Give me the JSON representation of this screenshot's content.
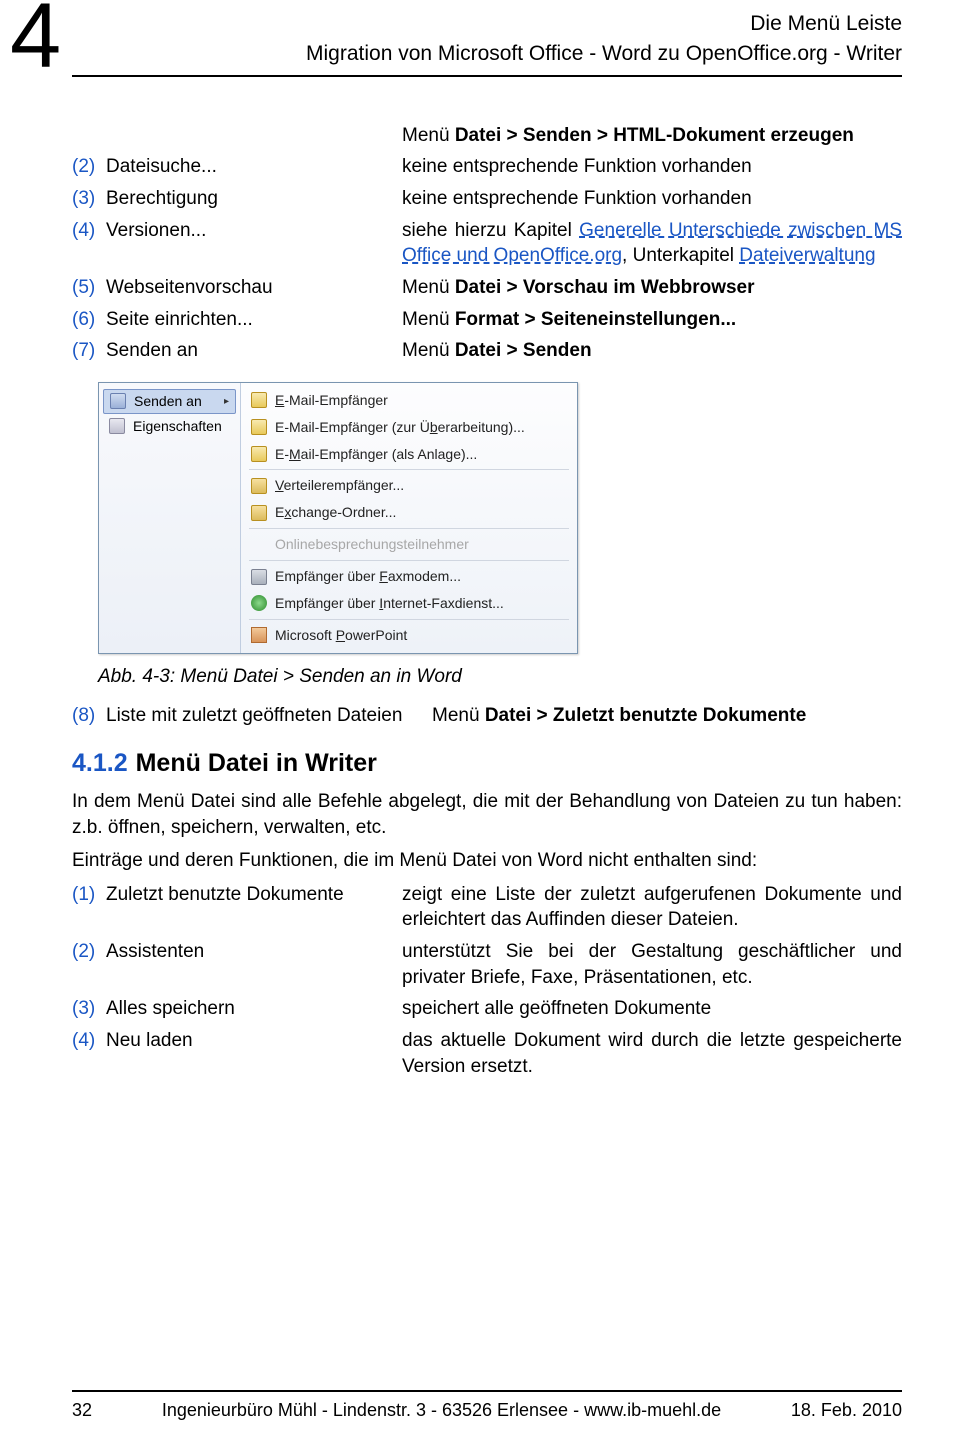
{
  "chapter": "4",
  "header": {
    "title": "Die Menü Leiste",
    "subtitle": "Migration von Microsoft Office - Word zu OpenOffice.org - Writer"
  },
  "intro_right": {
    "l1": "Menü ",
    "b1": "Datei > Senden > HTML-Dokument erzeugen"
  },
  "rows": [
    {
      "n": "(2)",
      "l": "Dateisuche...",
      "r_plain": "keine entsprechende Funktion vorhanden"
    },
    {
      "n": "(3)",
      "l": "Berechtigung",
      "r_plain": "keine entsprechende Funktion vorhanden"
    },
    {
      "n": "(4)",
      "l": "Versionen...",
      "r_pre": "siehe hierzu Kapitel ",
      "r_link1": "Generelle Unterschiede zwischen MS Office und OpenOffice.org",
      "r_mid": ", Unterkapitel ",
      "r_link2": "Dateiverwaltung"
    },
    {
      "n": "(5)",
      "l": "Webseitenvorschau",
      "r_pre": "Menü ",
      "r_bold": "Datei > Vorschau im Webbrowser"
    },
    {
      "n": "(6)",
      "l": "Seite einrichten...",
      "r_pre": "Menü ",
      "r_bold": "Format > Seiteneinstellungen..."
    },
    {
      "n": "(7)",
      "l": "Senden an",
      "r_pre": "Menü ",
      "r_bold": "Datei > Senden"
    }
  ],
  "figure": {
    "left": [
      {
        "label": "Senden an",
        "active": true,
        "icon": "ico-send"
      },
      {
        "label": "Eigenschaften",
        "icon": "ico-prop"
      }
    ],
    "right": [
      {
        "label": "E-Mail-Empfänger",
        "icon": "ico-mail",
        "u": "E"
      },
      {
        "label": "E-Mail-Empfänger (zur Überarbeitung)...",
        "icon": "ico-mail",
        "u": "b"
      },
      {
        "label": "E-Mail-Empfänger (als Anlage)...",
        "icon": "ico-mail",
        "u": "M"
      },
      {
        "sep": true
      },
      {
        "label": "Verteilerempfänger...",
        "icon": "ico-folder",
        "u": "V"
      },
      {
        "label": "Exchange-Ordner...",
        "icon": "ico-folder",
        "u": "x"
      },
      {
        "sep": true
      },
      {
        "label": "Onlinebesprechungsteilnehmer",
        "disabled": true
      },
      {
        "sep": true
      },
      {
        "label": "Empfänger über Faxmodem...",
        "icon": "ico-fax",
        "u": "F"
      },
      {
        "label": "Empfänger über Internet-Faxdienst...",
        "icon": "ico-net",
        "u": "I"
      },
      {
        "sep": true
      },
      {
        "label": "Microsoft PowerPoint",
        "icon": "ico-pp",
        "u": "P"
      }
    ]
  },
  "caption": "Abb. 4-3: Menü Datei > Senden an in Word",
  "row8": {
    "n": "(8)",
    "l": "Liste mit zuletzt geöffneten Dateien",
    "r_pre": "Menü ",
    "r_bold": "Datei > Zuletzt benutzte Dokumente"
  },
  "section": {
    "num": "4.1.2",
    "title": "Menü Datei in Writer",
    "p1": "In dem Menü Datei sind alle Befehle abgelegt, die mit der Behandlung von Dateien zu tun haben: z.b. öffnen, speichern, verwalten, etc.",
    "p2": "Einträge und deren Funktionen, die im Menü Datei von Word nicht enthalten sind:"
  },
  "list2": [
    {
      "n": "(1)",
      "l": "Zuletzt benutzte Dokumente",
      "r": "zeigt eine Liste der zuletzt aufgerufenen Dokumente und erleichtert das Auffinden dieser Dateien."
    },
    {
      "n": "(2)",
      "l": "Assistenten",
      "r": "unterstützt Sie bei der Gestaltung geschäftlicher und privater Briefe, Faxe, Präsentationen, etc."
    },
    {
      "n": "(3)",
      "l": "Alles speichern",
      "r": "speichert alle geöffneten Dokumente"
    },
    {
      "n": "(4)",
      "l": "Neu laden",
      "r": "das aktuelle Dokument wird durch die letzte gespeicherte Version ersetzt."
    }
  ],
  "footer": {
    "page": "32",
    "center": "Ingenieurbüro Mühl - Lindenstr. 3 - 63526 Erlensee - www.ib-muehl.de",
    "date": "18. Feb. 2010"
  }
}
